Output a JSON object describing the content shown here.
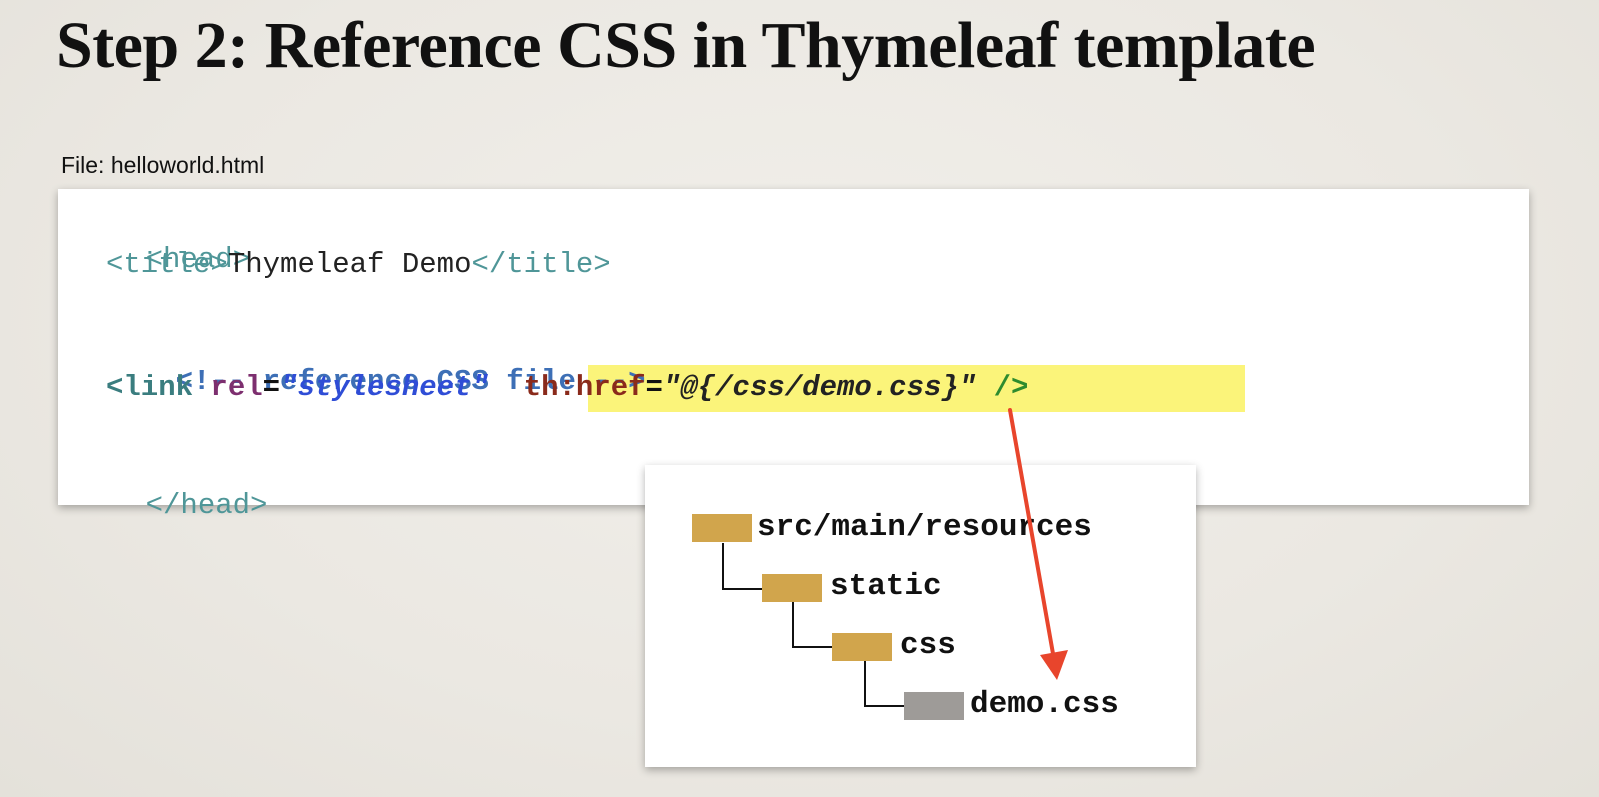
{
  "slide": {
    "title": "Step 2: Reference CSS in Thymeleaf template",
    "file_label": "File: helloworld.html"
  },
  "code": {
    "head_open": "<head>",
    "title_open": "<title>",
    "title_text": "Thymeleaf Demo",
    "title_close": "</title>",
    "comment": "<!-- reference CSS file -->",
    "link_open": "<link",
    "rel_attr": "rel",
    "eq": "=",
    "rel_value": "\"stylesheet\"",
    "th_attr": "th:href",
    "th_value": "\"@{/css/demo.css}\"",
    "self_close": "/>",
    "head_close": "</head>"
  },
  "tree": {
    "root": "src/main/resources",
    "static": "static",
    "css": "css",
    "file": "demo.css"
  },
  "colors": {
    "highlight": "#fbf47a",
    "folder": "#d1a54c",
    "file_icon": "#9e9b98",
    "arrow": "#e8452c"
  }
}
